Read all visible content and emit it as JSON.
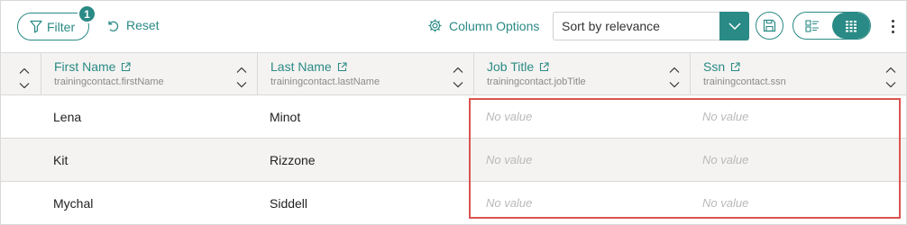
{
  "toolbar": {
    "filter_label": "Filter",
    "filter_count": "1",
    "reset_label": "Reset",
    "column_options_label": "Column Options",
    "sort_value": "Sort by relevance"
  },
  "icons": {
    "filter": "filter-funnel-icon",
    "reset": "undo-icon",
    "column_options": "gear-icon",
    "sort_dropdown": "chevron-down-icon",
    "save": "save-disk-icon",
    "list_view": "list-view-icon",
    "grid_view": "grid-view-icon",
    "more": "more-vertical-icon",
    "external_link": "external-link-icon"
  },
  "colors": {
    "accent": "#2a8a85",
    "header_bg": "#f4f3f1",
    "highlight": "#d9534f"
  },
  "columns": [
    {
      "title": "First Name",
      "field": "trainingcontact.firstName"
    },
    {
      "title": "Last Name",
      "field": "trainingcontact.lastName"
    },
    {
      "title": "Job Title",
      "field": "trainingcontact.jobTitle"
    },
    {
      "title": "Ssn",
      "field": "trainingcontact.ssn"
    }
  ],
  "rows": [
    {
      "firstName": "Lena",
      "lastName": "Minot",
      "jobTitle": "No value",
      "ssn": "No value"
    },
    {
      "firstName": "Kit",
      "lastName": "Rizzone",
      "jobTitle": "No value",
      "ssn": "No value"
    },
    {
      "firstName": "Mychal",
      "lastName": "Siddell",
      "jobTitle": "No value",
      "ssn": "No value"
    }
  ]
}
